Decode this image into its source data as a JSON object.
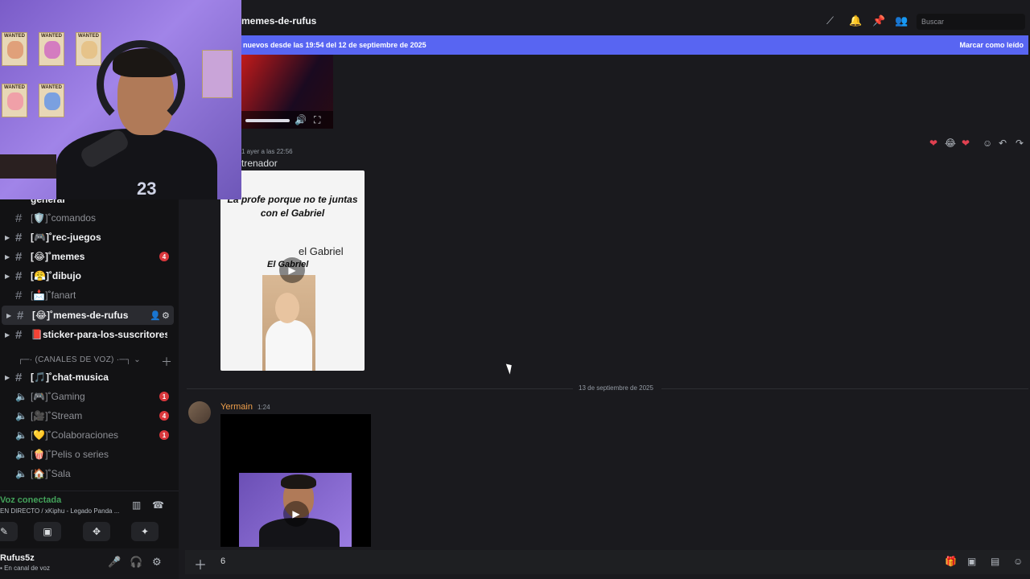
{
  "header": {
    "channel_name": "memes-de-rufus",
    "search_placeholder": "Buscar"
  },
  "banner": {
    "text": "nuevos desde las 19:54 del 12 de septiembre de 2025",
    "action": "Marcar como leído"
  },
  "sidebar": {
    "channels": [
      {
        "label": "general",
        "bold": true
      },
      {
        "label": "[🛡️]˚comandos",
        "bold": false
      },
      {
        "label": "[🎮]˚rec-juegos",
        "bold": true
      },
      {
        "label": "[😂]˚memes",
        "bold": true,
        "badge": "4"
      },
      {
        "label": "[😤]˚dibujo",
        "bold": true
      },
      {
        "label": "[📩]˚fanart",
        "bold": false
      },
      {
        "label": "[😂]˚memes-de-rufus",
        "bold": true,
        "active": true
      },
      {
        "label": "📕sticker-para-los-suscritores-...",
        "bold": true
      }
    ],
    "category": "(CANALES DE VOZ)",
    "voice_channels": [
      {
        "label": "[🎵]˚chat-musica",
        "bold": true
      },
      {
        "label": "[🎮]˚Gaming",
        "badge": "1"
      },
      {
        "label": "[🎥]˚Stream",
        "badge": "4"
      },
      {
        "label": "[💛]˚Colaboraciones",
        "badge": "1"
      },
      {
        "label": "[🍿]˚Pelis o series"
      },
      {
        "label": "[🏠]˚Sala"
      }
    ]
  },
  "voice": {
    "status": "Voz conectada",
    "detail": "EN DIRECTO / xKiphu - Legado Panda ..."
  },
  "user": {
    "name": "Rufus5z",
    "status": "En canal de voz"
  },
  "messages": {
    "first": {
      "meta": "1   ayer a las 22:56",
      "text": "trenador",
      "tiktok_caption": "La profe porque no te juntas con el Gabriel",
      "tiktok_name": "el Gabriel",
      "tiktok_name2": "El Gabriel"
    },
    "divider": "13 de septiembre de 2025",
    "second": {
      "author": "Yermain",
      "time": "1:24"
    }
  },
  "composer": {
    "value": "6"
  },
  "webcam": {
    "poster_label": "WANTED",
    "jersey_number": "23"
  },
  "colors": {
    "accent": "#5865f2",
    "danger": "#da373c",
    "voice_green": "#43a25a",
    "author": "#f0a04b"
  }
}
